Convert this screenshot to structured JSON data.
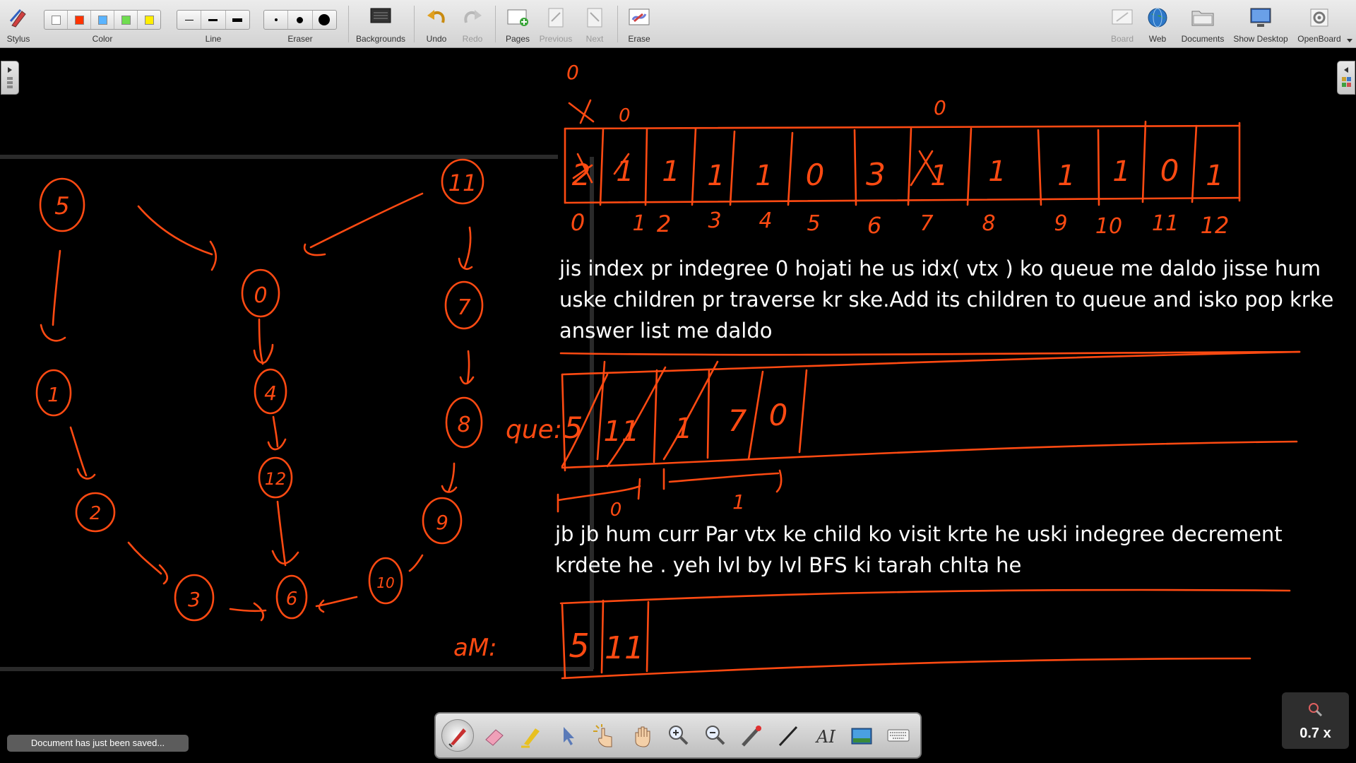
{
  "toolbar": {
    "stylus_label": "Stylus",
    "color_label": "Color",
    "line_label": "Line",
    "eraser_label": "Eraser",
    "backgrounds_label": "Backgrounds",
    "undo_label": "Undo",
    "redo_label": "Redo",
    "pages_label": "Pages",
    "previous_label": "Previous",
    "next_label": "Next",
    "erase_label": "Erase",
    "board_label": "Board",
    "web_label": "Web",
    "documents_label": "Documents",
    "show_desktop_label": "Show Desktop",
    "openboard_label": "OpenBoard",
    "colors": [
      "#ffffff",
      "#ff3300",
      "#5ab4ff",
      "#70dd50",
      "#ffee00"
    ]
  },
  "canvas": {
    "typed_text_1": [
      "jis index pr indegree 0 hojati he us idx( vtx ) ko queue me daldo jisse hum",
      "uske children pr traverse kr ske.Add its children to queue and isko pop krke",
      "answer list me daldo"
    ],
    "typed_text_2": [
      "jb jb hum curr Par vtx ke child ko visit krte he uski indegree decrement",
      "krdete he . yeh lvl by lvl BFS ki tarah chlta he"
    ],
    "ink_color": "#ff4a12",
    "graph_nodes": [
      "5",
      "11",
      "0",
      "7",
      "1",
      "4",
      "8",
      "2",
      "12",
      "9",
      "3",
      "6",
      "10"
    ],
    "indegree_values": [
      "2",
      "1",
      "1",
      "1",
      "1",
      "0",
      "3",
      "1",
      "1",
      "1",
      "1",
      "0",
      "1"
    ],
    "indegree_indices": [
      "0",
      "1",
      "2",
      "3",
      "4",
      "5",
      "6",
      "7",
      "8",
      "9",
      "10",
      "11",
      "12"
    ],
    "queue_label": "que:",
    "queue_items": [
      "5",
      "11",
      "1",
      "7",
      "0"
    ],
    "queue_level_marks": [
      "0",
      "1"
    ],
    "answer_label": "aM:",
    "answer_items": [
      "5",
      "11"
    ],
    "top_marks": [
      "0",
      "0",
      "0"
    ]
  },
  "palette": {
    "tools": [
      "pen-tool",
      "eraser-tool",
      "marker-tool",
      "selector-tool",
      "interact-tool",
      "hand-tool",
      "zoom-in-tool",
      "zoom-out-tool",
      "laser-pointer-tool",
      "line-tool",
      "text-tool",
      "capture-tool",
      "keyboard-tool"
    ]
  },
  "zoom": {
    "value": "0.7 x"
  },
  "status": {
    "message": "Document has just been saved..."
  }
}
